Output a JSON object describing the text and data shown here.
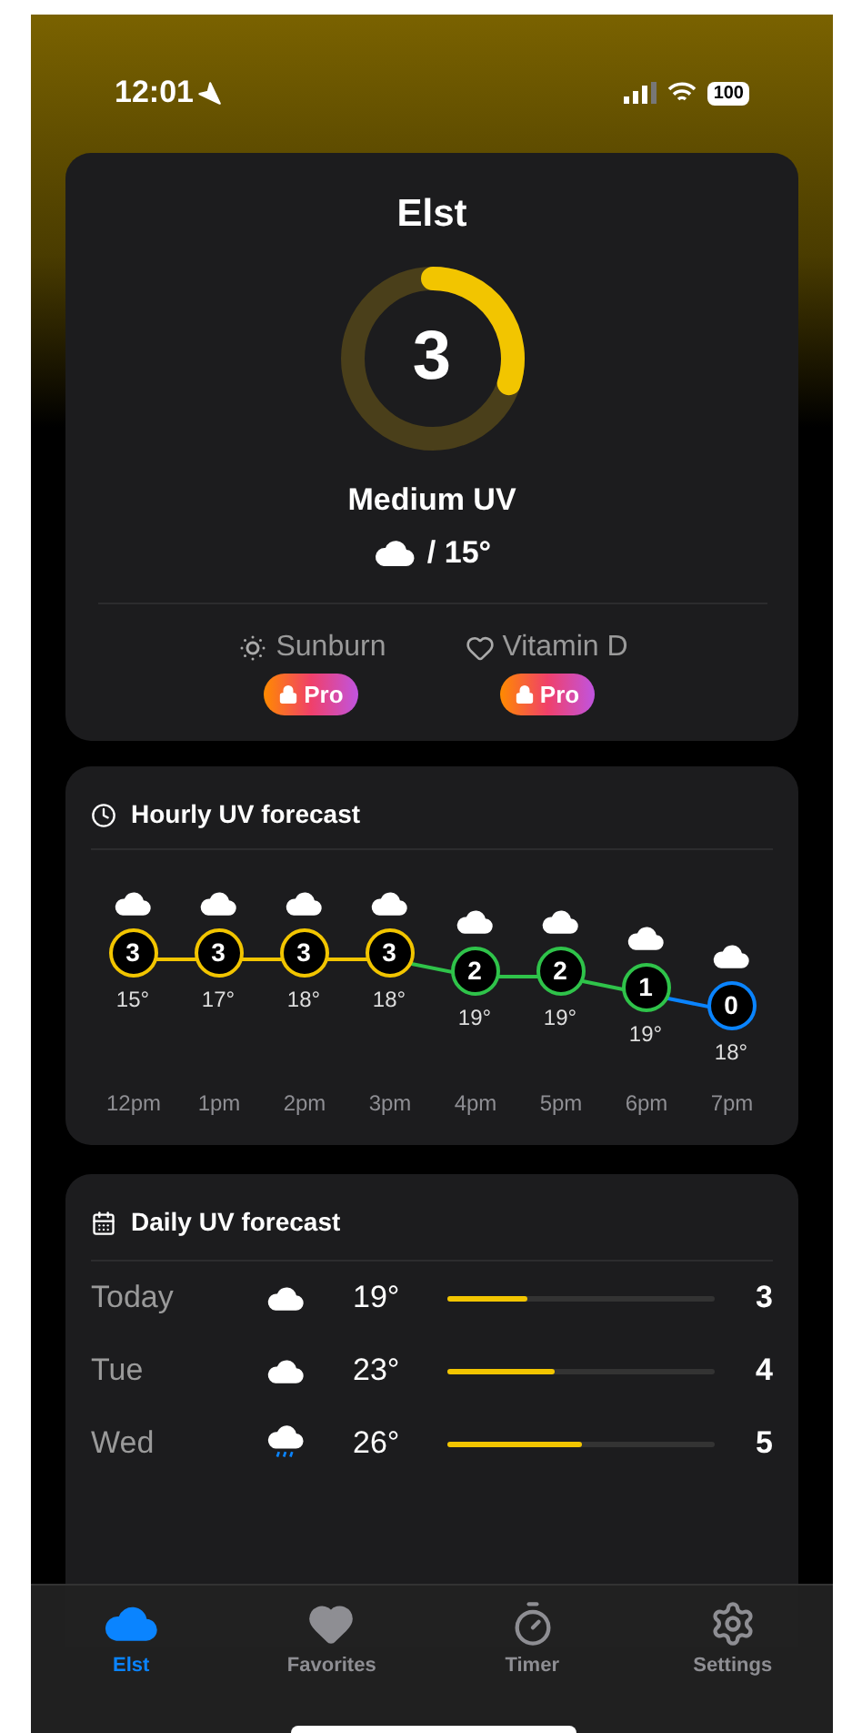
{
  "status_bar": {
    "time": "12:01",
    "battery": "100"
  },
  "current": {
    "location": "Elst",
    "uv": "3",
    "label": "Medium UV",
    "temperature": "/ 15°"
  },
  "pro_features": [
    {
      "label": "Sunburn",
      "badge": "Pro",
      "kind": "sunburn"
    },
    {
      "label": "Vitamin D",
      "badge": "Pro",
      "kind": "vitamin"
    }
  ],
  "hourly": {
    "title": "Hourly UV forecast",
    "hours": [
      {
        "time": "12pm",
        "uv": "3",
        "temp": "15°",
        "color": "#f2c500"
      },
      {
        "time": "1pm",
        "uv": "3",
        "temp": "17°",
        "color": "#f2c500"
      },
      {
        "time": "2pm",
        "uv": "3",
        "temp": "18°",
        "color": "#f2c500"
      },
      {
        "time": "3pm",
        "uv": "3",
        "temp": "18°",
        "color": "#f2c500"
      },
      {
        "time": "4pm",
        "uv": "2",
        "temp": "19°",
        "color": "#2fc34a"
      },
      {
        "time": "5pm",
        "uv": "2",
        "temp": "19°",
        "color": "#2fc34a"
      },
      {
        "time": "6pm",
        "uv": "1",
        "temp": "19°",
        "color": "#2fc34a"
      },
      {
        "time": "7pm",
        "uv": "0",
        "temp": "18°",
        "color": "#0a84ff"
      }
    ]
  },
  "daily": {
    "title": "Daily UV forecast",
    "days": [
      {
        "day": "Today",
        "kind": "cloud",
        "temp": "19°",
        "level": 0.3,
        "uv": "3"
      },
      {
        "day": "Tue",
        "kind": "cloud",
        "temp": "23°",
        "level": 0.4,
        "uv": "4"
      },
      {
        "day": "Wed",
        "kind": "rain",
        "temp": "26°",
        "level": 0.5,
        "uv": "5"
      }
    ]
  },
  "tabs": [
    {
      "label": "Elst",
      "kind": "cloud",
      "selected": true
    },
    {
      "label": "Favorites",
      "kind": "heart",
      "selected": false
    },
    {
      "label": "Timer",
      "kind": "timer",
      "selected": false
    },
    {
      "label": "Settings",
      "kind": "gear",
      "selected": false
    }
  ]
}
